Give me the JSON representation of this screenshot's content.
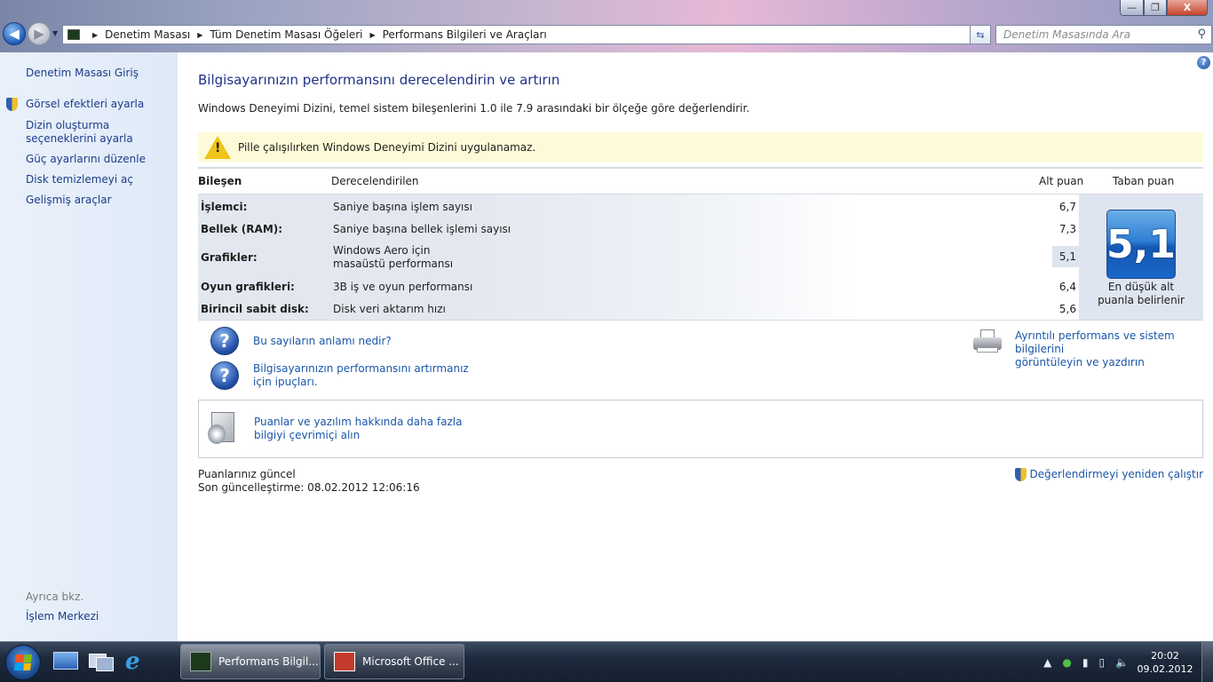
{
  "window": {
    "minimize": "—",
    "maximize": "❐",
    "close": "X"
  },
  "address": {
    "crumbs": [
      "Denetim Masası",
      "Tüm Denetim Masası Öğeleri",
      "Performans Bilgileri ve Araçları"
    ],
    "search_placeholder": "Denetim Masasında Ara"
  },
  "sidebar": {
    "home": "Denetim Masası Giriş",
    "items": [
      {
        "label": "Görsel efektleri ayarla",
        "shield": true
      },
      {
        "label": "Dizin oluşturma seçeneklerini ayarla"
      },
      {
        "label": "Güç ayarlarını düzenle"
      },
      {
        "label": "Disk temizlemeyi aç"
      },
      {
        "label": "Gelişmiş araçlar"
      }
    ],
    "see_also": "Ayrıca bkz.",
    "see_also_link": "İşlem Merkezi"
  },
  "main": {
    "title": "Bilgisayarınızın performansını derecelendirin ve artırın",
    "subtitle": "Windows Deneyimi Dizini, temel sistem bileşenlerini 1.0 ile 7.9 arasındaki bir ölçeğe göre değerlendirir.",
    "warning": "Pille çalışılırken Windows Deneyimi Dizini uygulanamaz.",
    "table": {
      "headers": {
        "component": "Bileşen",
        "rated": "Derecelendirilen",
        "subscore": "Alt puan",
        "basescore": "Taban puan"
      },
      "rows": [
        {
          "component": "İşlemci:",
          "desc": "Saniye başına işlem sayısı",
          "score": "6,7"
        },
        {
          "component": "Bellek (RAM):",
          "desc": "Saniye başına bellek işlemi sayısı",
          "score": "7,3"
        },
        {
          "component": "Grafikler:",
          "desc": "Windows Aero için masaüstü performansı",
          "score": "5,1"
        },
        {
          "component": "Oyun grafikleri:",
          "desc": "3B iş ve oyun performansı",
          "score": "6,4"
        },
        {
          "component": "Birincil sabit disk:",
          "desc": "Disk veri aktarım hızı",
          "score": "5,6"
        }
      ],
      "base_score": "5,1",
      "base_caption_1": "En düşük alt",
      "base_caption_2": "puanla belirlenir"
    },
    "links": {
      "meaning": "Bu sayıların anlamı nedir?",
      "tips_1": "Bilgisayarınızın performansını artırmanız",
      "tips_2": "için ipuçları.",
      "details_1": "Ayrıntılı performans ve sistem bilgilerini",
      "details_2": "görüntüleyin ve yazdırın",
      "online_1": "Puanlar ve yazılım hakkında daha fazla",
      "online_2": "bilgiyi çevrimiçi alın"
    },
    "status": {
      "current": "Puanlarınız güncel",
      "last_update": "Son güncelleştirme: 08.02.2012 12:06:16",
      "rerun": "Değerlendirmeyi yeniden çalıştır"
    }
  },
  "taskbar": {
    "tasks": [
      {
        "label": "Performans Bilgil...",
        "active": true
      },
      {
        "label": "Microsoft Office ...",
        "active": false
      }
    ],
    "time": "20:02",
    "date": "09.02.2012"
  },
  "colors": {
    "link": "#1a56a8",
    "title": "#1e3287",
    "warning_bg": "#fefad8",
    "badge": "#1a66c6"
  }
}
